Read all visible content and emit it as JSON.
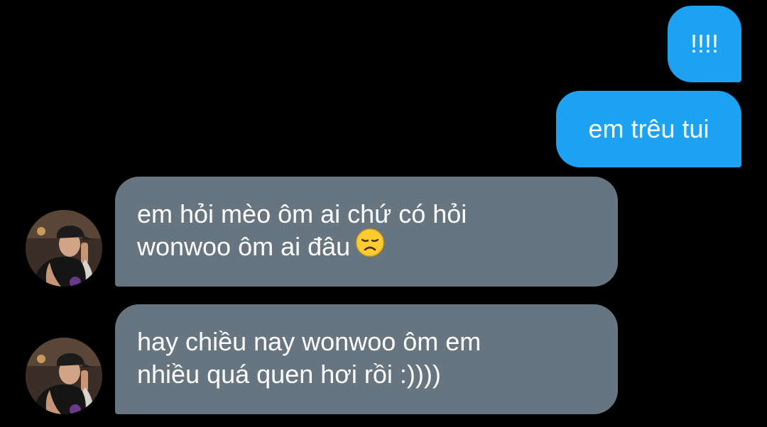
{
  "conversation": {
    "messages": [
      {
        "direction": "outgoing",
        "text": "!!!!"
      },
      {
        "direction": "outgoing",
        "text": "em trêu tui"
      },
      {
        "direction": "incoming",
        "lines": [
          "em hỏi mèo ôm ai chứ có hỏi",
          "wonwoo ôm ai đâu"
        ],
        "emoji": "disappointed-face-icon"
      },
      {
        "direction": "incoming",
        "lines": [
          "hay chiều nay wonwoo ôm em",
          "nhiều quá quen hơi rồi :))))"
        ]
      }
    ]
  },
  "colors": {
    "background": "#000000",
    "outgoing_bubble": "#1da1f2",
    "incoming_bubble": "#66757f",
    "text": "#ffffff"
  }
}
